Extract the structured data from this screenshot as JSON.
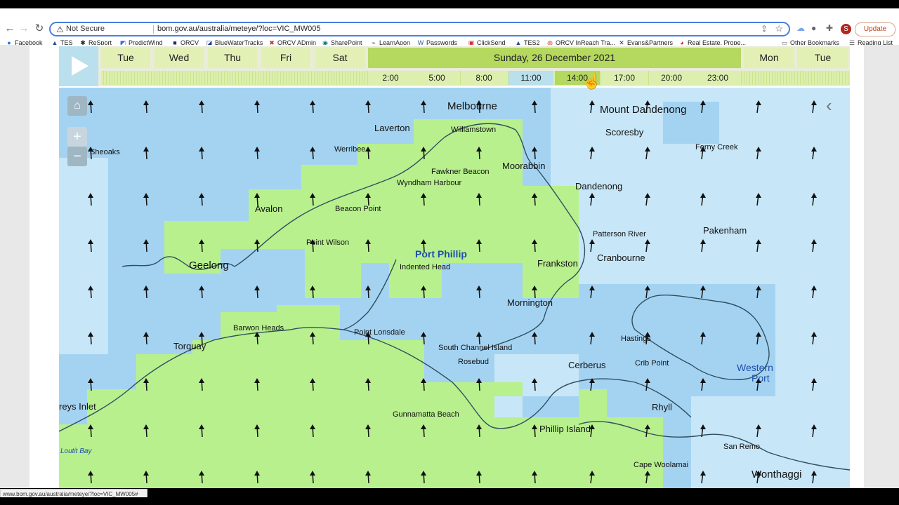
{
  "browser": {
    "security_label": "Not Secure",
    "url": "bom.gov.au/australia/meteye/?loc=VIC_MW005",
    "update_label": "Update",
    "profile_initial": "S"
  },
  "bookmarks": [
    {
      "label": "Facebook",
      "icon": "facebook-icon"
    },
    {
      "label": "TES",
      "icon": "sail-icon"
    },
    {
      "label": "ReSport",
      "icon": "gear-icon"
    },
    {
      "label": "PredictWind",
      "icon": "predictwind-icon"
    },
    {
      "label": "ORCV",
      "icon": "orcv-icon"
    },
    {
      "label": "BlueWaterTracks",
      "icon": "bluewater-icon"
    },
    {
      "label": "ORCV ADmin",
      "icon": "tools-icon"
    },
    {
      "label": "SharePoint",
      "icon": "sharepoint-icon"
    },
    {
      "label": "LearnApon",
      "icon": "learn-icon"
    },
    {
      "label": "Passwords",
      "icon": "word-icon"
    },
    {
      "label": "ClickSend",
      "icon": "clicksend-icon"
    },
    {
      "label": "TES2",
      "icon": "sail-icon"
    },
    {
      "label": "ORCV InReach Tra...",
      "icon": "chrome-icon"
    },
    {
      "label": "Evans&Partners",
      "icon": "x-icon"
    },
    {
      "label": "Real Estate, Prope...",
      "icon": "realestate-icon"
    }
  ],
  "bookmarks_right": {
    "other": "Other Bookmarks",
    "reading": "Reading List"
  },
  "timeline": {
    "days": [
      "Tue",
      "Wed",
      "Thu",
      "Fri",
      "Sat",
      "Sunday, 26 December 2021",
      "Mon",
      "Tue"
    ],
    "hours": [
      "2:00",
      "5:00",
      "8:00",
      "11:00",
      "14:00",
      "17:00",
      "20:00",
      "23:00"
    ]
  },
  "places": [
    "Melbourne",
    "Mount Dandenong",
    "Laverton",
    "Williamstown",
    "Scoresby",
    "Sheoaks",
    "Werribee",
    "Ferny Creek",
    "Fawkner Beacon",
    "Moorabbin",
    "Wyndham Harbour",
    "Dandenong",
    "Avalon",
    "Beacon Point",
    "Patterson River",
    "Pakenham",
    "Point Wilson",
    "Port Phillip",
    "Cranbourne",
    "Geelong",
    "Indented Head",
    "Frankston",
    "Mornington",
    "Barwon Heads",
    "Point Lonsdale",
    "Torquay",
    "Hastings",
    "South Channel Island",
    "Rosebud",
    "Cerberus",
    "Crib Point",
    "Western",
    "Port",
    "reys Inlet",
    "Rhyll",
    "Gunnamatta Beach",
    "Phillip Island",
    "San Remo",
    "Loutit Bay",
    "Cape Woolamai",
    "Wonthaggi"
  ],
  "status_url": "www.bom.gov.au/australia/meteye/?loc=VIC_MW005#",
  "colors": {
    "land_green": "#b8f08e",
    "sea_blue": "#a4d3f2",
    "pale_blue": "#c7e6f8"
  }
}
